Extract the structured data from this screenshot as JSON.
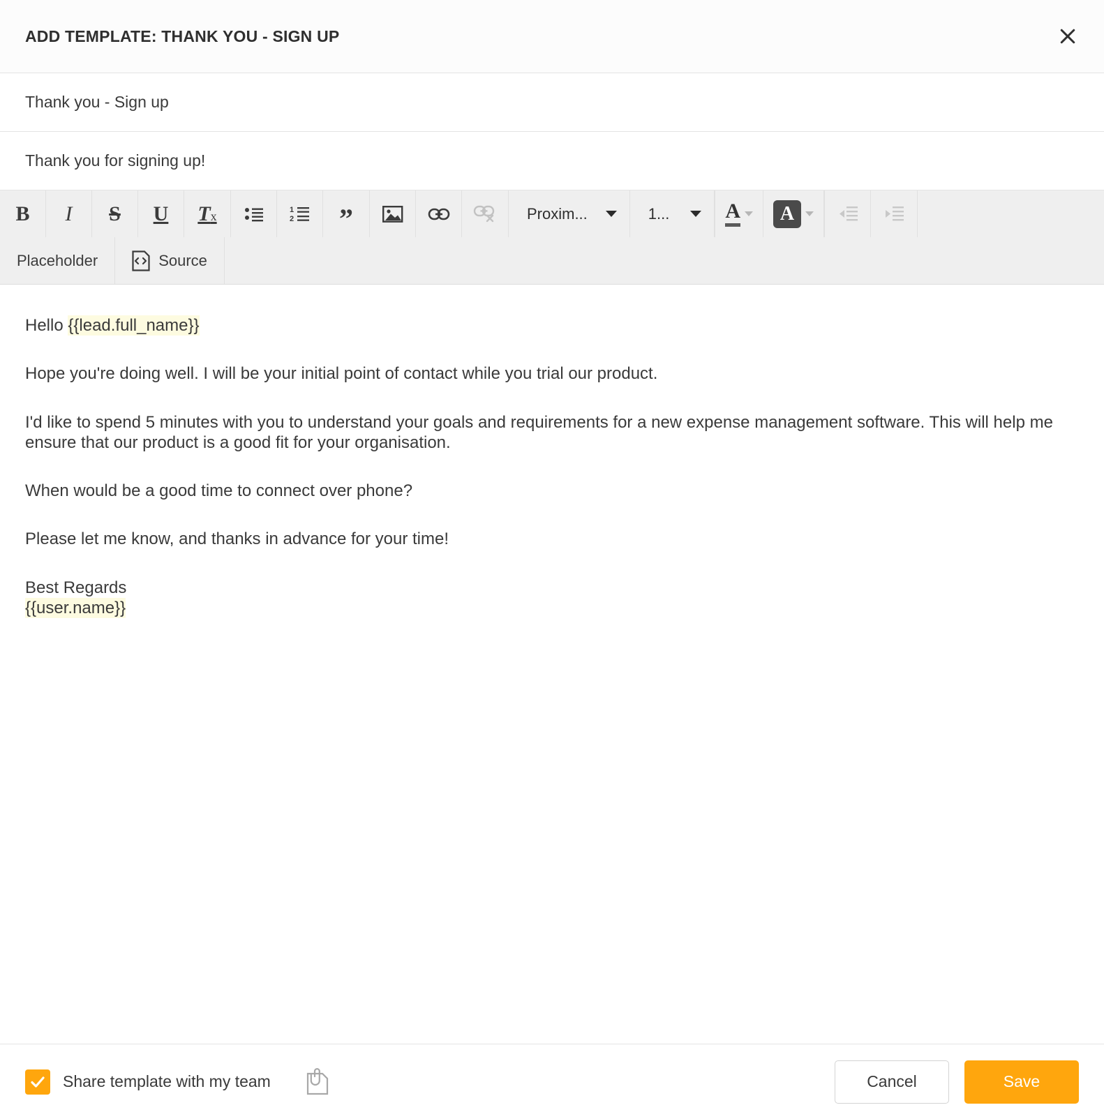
{
  "header": {
    "title": "ADD TEMPLATE: THANK YOU - SIGN UP",
    "close_icon": "close-icon"
  },
  "fields": {
    "template_name": {
      "value": "Thank you - Sign up",
      "placeholder": "Template name"
    },
    "subject": {
      "value": "Thank you for signing up!",
      "placeholder": "Subject"
    }
  },
  "toolbar": {
    "bold": "B",
    "italic": "I",
    "strikethrough": "S",
    "underline": "U",
    "remove_format": "Tx",
    "bulleted_list": "bulleted-list-icon",
    "numbered_list": "numbered-list-icon",
    "blockquote": "”",
    "image": "image-icon",
    "link": "link-icon",
    "unlink": "unlink-icon",
    "font_family": "Proxim...",
    "font_size": "1...",
    "text_color": "A",
    "background_color": "A",
    "decrease_indent": "decrease-indent-icon",
    "increase_indent": "increase-indent-icon",
    "placeholder_label": "Placeholder",
    "source_label": "Source"
  },
  "body": {
    "greeting_prefix": "Hello ",
    "greeting_placeholder": "{{lead.full_name}}",
    "paragraph_1": "Hope you're doing well. I will be your initial point of contact while you trial our product.",
    "paragraph_2": "I'd like to spend 5 minutes with you to understand your goals and requirements for a new expense management software. This will help me ensure that our product is a good fit for your organisation.",
    "paragraph_3": "When would be a good time to connect over phone?",
    "paragraph_4": "Please let me know, and thanks in advance for your time!",
    "signoff": "Best Regards",
    "signature_placeholder": "{{user.name}}"
  },
  "footer": {
    "share_label": "Share template with my team",
    "share_checked": true,
    "attachment_icon": "attachment-icon",
    "cancel_label": "Cancel",
    "save_label": "Save"
  },
  "colors": {
    "accent": "#ffa60d",
    "placeholder_highlight": "#fdfbe0",
    "toolbar_bg": "#efefef",
    "border": "#e4e4e4"
  }
}
